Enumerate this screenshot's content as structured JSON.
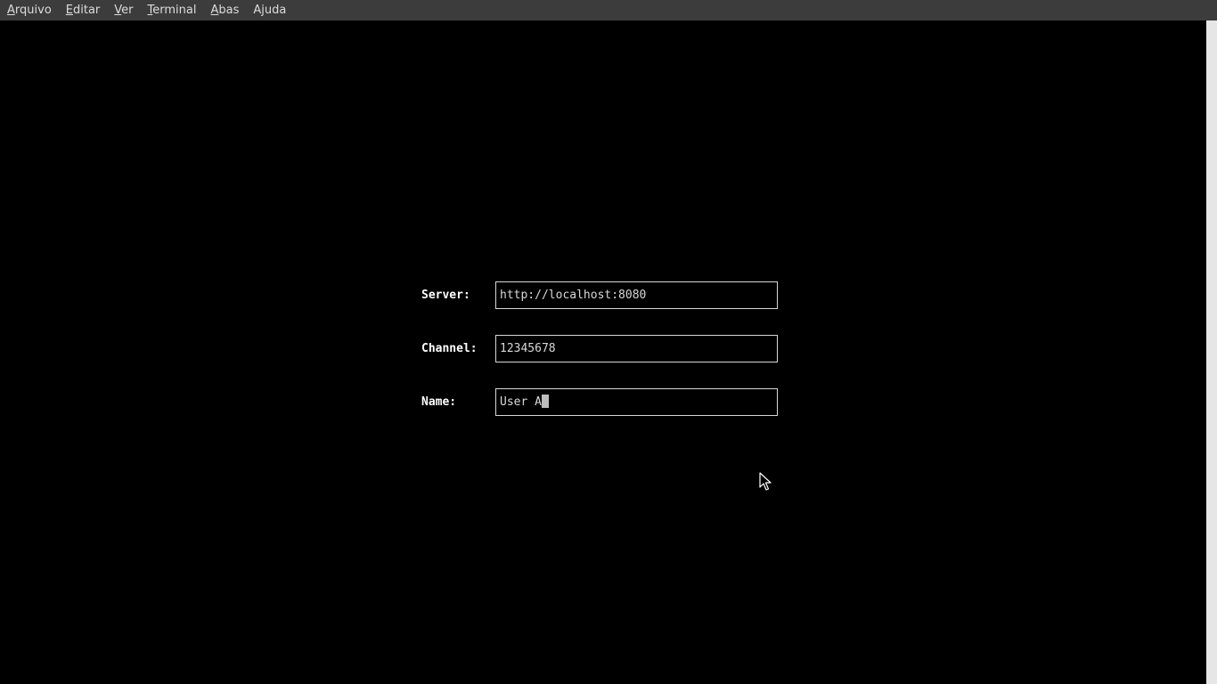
{
  "menubar": {
    "items": [
      {
        "mnemonic": "A",
        "rest": "rquivo"
      },
      {
        "mnemonic": "E",
        "rest": "ditar"
      },
      {
        "mnemonic": "V",
        "rest": "er"
      },
      {
        "mnemonic": "T",
        "rest": "erminal"
      },
      {
        "mnemonic": "A",
        "rest": "bas"
      },
      {
        "pre": "A",
        "mnemonic": "j",
        "rest": "uda"
      }
    ]
  },
  "form": {
    "server": {
      "label": "Server:",
      "value": "http://localhost:8080"
    },
    "channel": {
      "label": "Channel:",
      "value": "12345678"
    },
    "name": {
      "label": "Name:",
      "value": "User A"
    }
  },
  "colors": {
    "background": "#000000",
    "menubar": "#3c3c3c",
    "text": "#d8d8d8"
  },
  "icons": {
    "pointer": "mouse-pointer-icon"
  }
}
